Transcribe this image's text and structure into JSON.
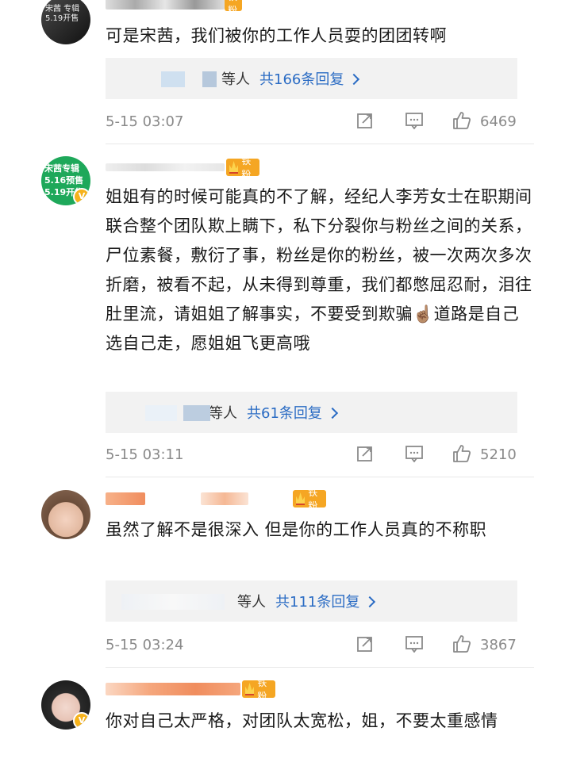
{
  "comments": [
    {
      "top": 0,
      "avatar_bg": "linear-gradient(135deg,#3a3a3a,#0f0f0f)",
      "avatar_label": "宋茜\n专辑\n5.19开售",
      "avatar_text_color": "#e9e9e9",
      "has_v": false,
      "fan_badge": "铁粉",
      "text": "可是宋茜，我们被你的工作人员耍的团团转啊",
      "reply_who": "等人",
      "reply_total": "共166条回复",
      "time": "5-15 03:07",
      "likes": "6469"
    },
    {
      "fan_badge": "铁粉",
      "text": "姐姐有的时候可能真的不了解，经纪人李芳女士在职期间联合整个团队欺上瞒下，私下分裂你与粉丝之间的关系，尸位素餐，敷衍了事，粉丝是你的粉丝，被一次两次多次折磨，被看不起，从未得到尊重，我们都憋屈忍耐，泪往肚里流，请姐姐了解事实，不要受到欺骗☝🏽道路是自己选自己走，愿姐姐飞更高哦",
      "reply_who": "等人",
      "reply_total": "共61条回复",
      "time": "5-15 03:11",
      "likes": "5210",
      "avatar_label": "宋茜专辑\n5.16预售\n5.19开售"
    },
    {
      "fan_badge": "铁粉",
      "text": "虽然了解不是很深入 但是你的工作人员真的不称职",
      "reply_who": "等人",
      "reply_total": "共111条回复",
      "time": "5-15 03:24",
      "likes": "3867"
    },
    {
      "fan_badge": "铁粉",
      "text": "你对自己太严格，对团队太宽松，姐，不要太重感情"
    }
  ],
  "colors": {
    "link": "#2b6cc4",
    "meta": "#8a8a8a",
    "badge": "#f5a623",
    "reply_bg": "#f2f2f2"
  },
  "icons": [
    "share-icon",
    "comment-icon",
    "thumbs-up-icon",
    "chevron-right-icon",
    "crown-icon"
  ]
}
